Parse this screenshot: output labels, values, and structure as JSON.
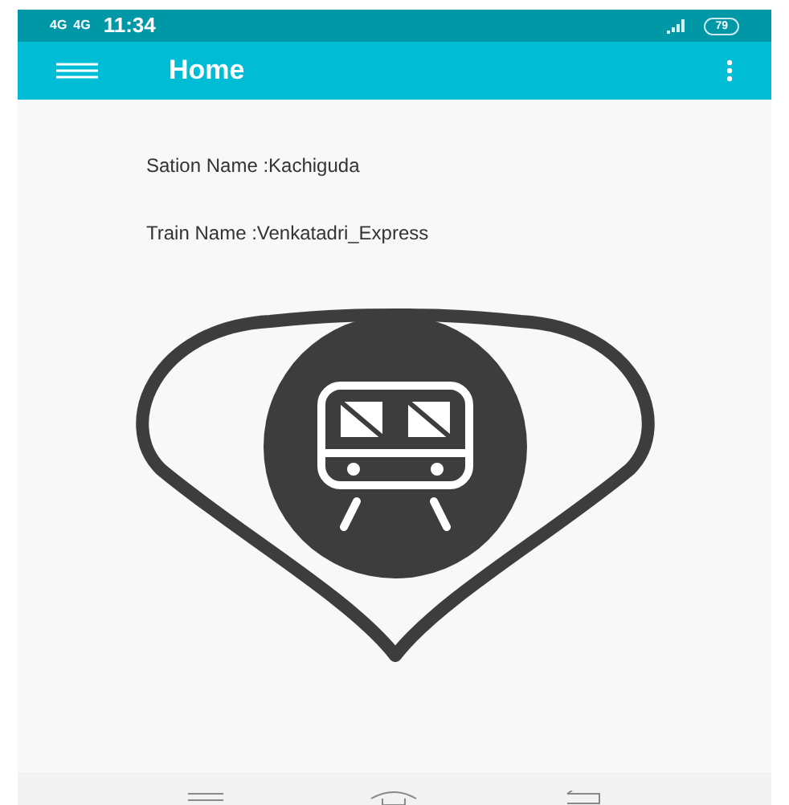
{
  "status_bar": {
    "signal_labels": [
      "4G",
      "4G"
    ],
    "time": "11:34",
    "battery": "79"
  },
  "app_bar": {
    "title": "Home"
  },
  "details": [
    "Sation Name :Kachiguda",
    "Train Name :Venkatadri_Express"
  ]
}
